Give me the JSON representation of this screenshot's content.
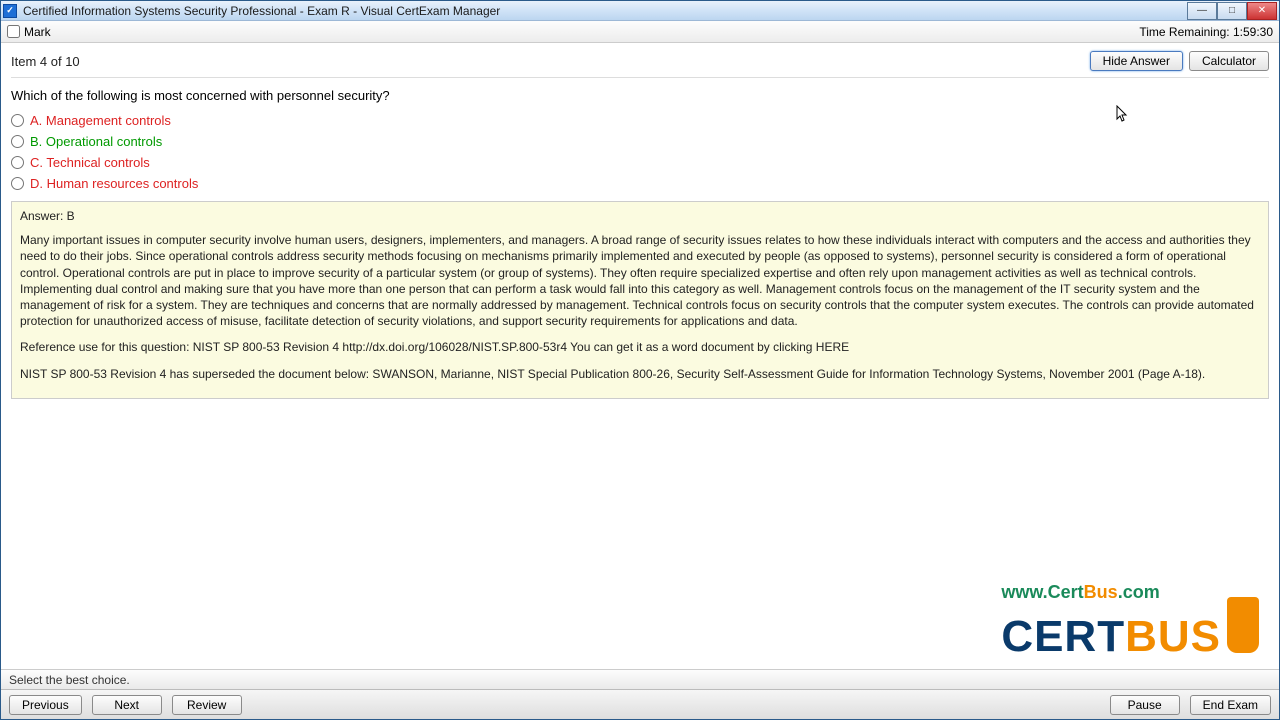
{
  "titlebar": {
    "app_icon_char": "✓",
    "title": "Certified Information Systems Security Professional - Exam R - Visual CertExam Manager"
  },
  "markbar": {
    "mark_label": "Mark",
    "time_label": "Time Remaining: 1:59:30"
  },
  "header": {
    "item_label": "Item 4 of 10",
    "hide_answer": "Hide Answer",
    "calculator": "Calculator"
  },
  "question": "Which of the following is most concerned with personnel security?",
  "options": {
    "a": "A.  Management controls",
    "b": "B.  Operational controls",
    "c": "C.  Technical controls",
    "d": "D.  Human resources controls"
  },
  "answer": {
    "head": "Answer: B",
    "p1": "Many important issues in computer security involve human users, designers, implementers, and managers.\nA broad range of security issues relates to how these individuals interact with computers and the access and authorities they need to do their jobs. Since operational controls address security methods focusing on mechanisms primarily implemented and executed by people (as opposed to systems), personnel security is considered a form of operational control. Operational controls are put in place to improve security of a particular system (or group of systems). They often require specialized expertise and often rely upon management activities as well as technical controls. Implementing dual control and making sure that you have more than one person that can perform a task would fall into this category as well. Management controls focus on the management of the IT security system and the management of risk for a system. They are techniques and concerns that are normally addressed by management. Technical controls focus on security controls that the computer system executes. The controls can provide automated protection for unauthorized access of misuse, facilitate detection of security violations, and support security requirements for applications and data.",
    "p2": "Reference use for this question:\nNIST SP 800-53 Revision 4 http://dx.doi.org/106028/NIST.SP.800-53r4 You can get it as a word document by clicking HERE",
    "p3": "NIST SP 800-53 Revision 4 has superseded the document below:\nSWANSON, Marianne, NIST Special Publication 800-26, Security Self-Assessment Guide for Information Technology Systems, November 2001 (Page A-18)."
  },
  "watermark": {
    "url_www": "www.",
    "url_cert": "Cert",
    "url_bus": "Bus",
    "url_com": ".com",
    "logo_cert": "CERT",
    "logo_bus": "BUS"
  },
  "statusbar": {
    "hint": "Select the best choice."
  },
  "bottombar": {
    "previous": "Previous",
    "next": "Next",
    "review": "Review",
    "pause": "Pause",
    "end": "End Exam"
  }
}
